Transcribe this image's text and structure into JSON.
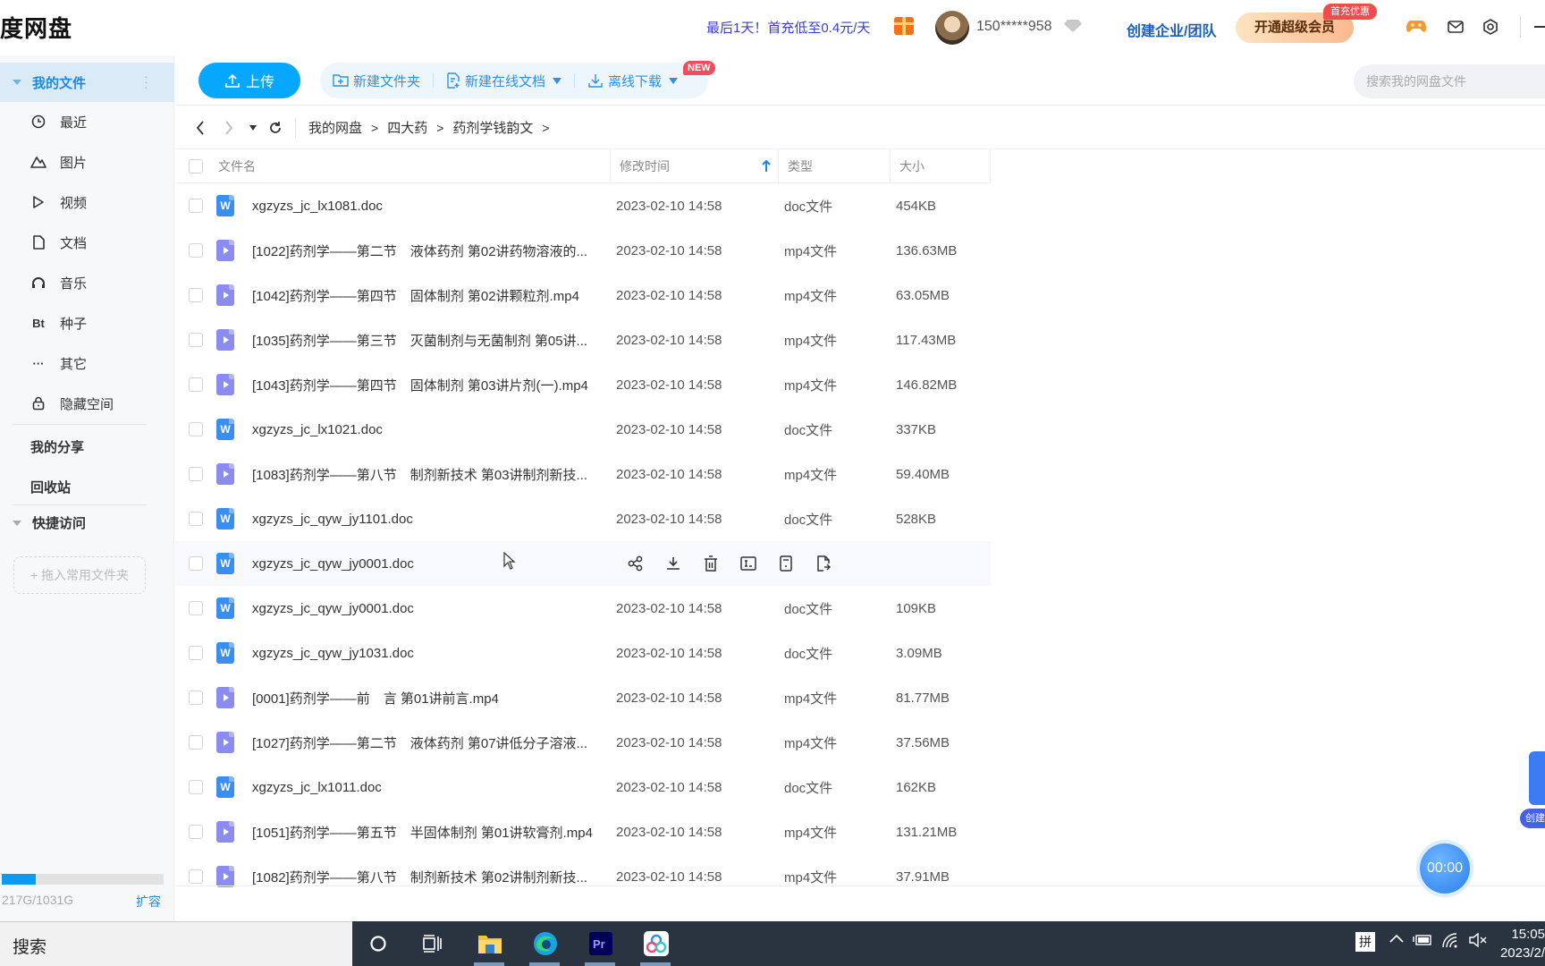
{
  "app": {
    "logo_text": "度网盘"
  },
  "header": {
    "promo": "最后1天！首充低至0.4元/天",
    "username": "150*****958",
    "create_team": "创建企业/团队",
    "vip_button": "开通超级会员",
    "vip_badge": "首充优惠"
  },
  "sidebar": {
    "my_files": "我的文件",
    "items": [
      {
        "label": "最近",
        "icon": "clock-icon"
      },
      {
        "label": "图片",
        "icon": "image-icon"
      },
      {
        "label": "视频",
        "icon": "video-icon"
      },
      {
        "label": "文档",
        "icon": "document-icon"
      },
      {
        "label": "音乐",
        "icon": "headphones-icon"
      },
      {
        "label": "种子",
        "icon": "bt-icon",
        "glyph": "Bt"
      },
      {
        "label": "其它",
        "icon": "more-icon",
        "glyph": "···"
      },
      {
        "label": "隐藏空间",
        "icon": "lock-icon"
      }
    ],
    "my_share": "我的分享",
    "recycle_bin": "回收站",
    "quick_access": "快捷访问",
    "drop_folder": "+ 拖入常用文件夹",
    "storage_text": "217G/1031G",
    "storage_used_fraction": 0.21,
    "expand": "扩容"
  },
  "toolbar": {
    "upload": "上传",
    "new_folder": "新建文件夹",
    "new_online_doc": "新建在线文档",
    "new_badge": "NEW",
    "offline_download": "离线下载",
    "search_placeholder": "搜索我的网盘文件"
  },
  "breadcrumb": [
    "我的网盘",
    "四大药",
    "药剂学钱韵文"
  ],
  "table": {
    "headers": {
      "name": "文件名",
      "time": "修改时间",
      "type": "类型",
      "size": "大小"
    },
    "rows": [
      {
        "name": "xgzyzs_jc_lx1081.doc",
        "kind": "doc",
        "time": "2023-02-10 14:58",
        "type": "doc文件",
        "size": "454KB"
      },
      {
        "name": "[1022]药剂学——第二节　液体药剂 第02讲药物溶液的...",
        "kind": "mp4",
        "time": "2023-02-10 14:58",
        "type": "mp4文件",
        "size": "136.63MB"
      },
      {
        "name": "[1042]药剂学——第四节　固体制剂 第02讲颗粒剂.mp4",
        "kind": "mp4",
        "time": "2023-02-10 14:58",
        "type": "mp4文件",
        "size": "63.05MB"
      },
      {
        "name": "[1035]药剂学——第三节　灭菌制剂与无菌制剂 第05讲...",
        "kind": "mp4",
        "time": "2023-02-10 14:58",
        "type": "mp4文件",
        "size": "117.43MB"
      },
      {
        "name": "[1043]药剂学——第四节　固体制剂 第03讲片剂(一).mp4",
        "kind": "mp4",
        "time": "2023-02-10 14:58",
        "type": "mp4文件",
        "size": "146.82MB"
      },
      {
        "name": "xgzyzs_jc_lx1021.doc",
        "kind": "doc",
        "time": "2023-02-10 14:58",
        "type": "doc文件",
        "size": "337KB"
      },
      {
        "name": "[1083]药剂学——第八节　制剂新技术 第03讲制剂新技...",
        "kind": "mp4",
        "time": "2023-02-10 14:58",
        "type": "mp4文件",
        "size": "59.40MB"
      },
      {
        "name": "xgzyzs_jc_qyw_jy1101.doc",
        "kind": "doc",
        "time": "2023-02-10 14:58",
        "type": "doc文件",
        "size": "528KB"
      },
      {
        "name": "xgzyzs_jc_qyw_jy0001.doc",
        "kind": "doc",
        "time": "",
        "type": "",
        "size": "",
        "hover": true
      },
      {
        "name": "xgzyzs_jc_qyw_jy0001.doc",
        "kind": "doc",
        "time": "2023-02-10 14:58",
        "type": "doc文件",
        "size": "109KB"
      },
      {
        "name": "xgzyzs_jc_qyw_jy1031.doc",
        "kind": "doc",
        "time": "2023-02-10 14:58",
        "type": "doc文件",
        "size": "3.09MB"
      },
      {
        "name": "[0001]药剂学——前　言 第01讲前言.mp4",
        "kind": "mp4",
        "time": "2023-02-10 14:58",
        "type": "mp4文件",
        "size": "81.77MB"
      },
      {
        "name": "[1027]药剂学——第二节　液体药剂 第07讲低分子溶液...",
        "kind": "mp4",
        "time": "2023-02-10 14:58",
        "type": "mp4文件",
        "size": "37.56MB"
      },
      {
        "name": "xgzyzs_jc_lx1011.doc",
        "kind": "doc",
        "time": "2023-02-10 14:58",
        "type": "doc文件",
        "size": "162KB"
      },
      {
        "name": "[1051]药剂学——第五节　半固体制剂 第01讲软膏剂.mp4",
        "kind": "mp4",
        "time": "2023-02-10 14:58",
        "type": "mp4文件",
        "size": "131.21MB"
      },
      {
        "name": "[1082]药剂学——第八节　制剂新技术 第02讲制剂新技...",
        "kind": "mp4",
        "time": "2023-02-10 14:58",
        "type": "mp4文件",
        "size": "37.91MB"
      }
    ],
    "row_actions": [
      "share-icon",
      "download-icon",
      "delete-icon",
      "rename-icon",
      "move-icon",
      "copy-icon"
    ]
  },
  "floating": {
    "timer": "00:00",
    "side_tag": "创建"
  },
  "taskbar": {
    "search": "搜索",
    "ime": "拼",
    "time": "15:05",
    "date": "2023/2/"
  },
  "colors": {
    "accent": "#06a7ff",
    "link": "#2f8fe3",
    "sidebar_active_bg": "#daeaf7",
    "doc_icon": "#3a8ef0",
    "video_icon": "#8a8cf2"
  }
}
